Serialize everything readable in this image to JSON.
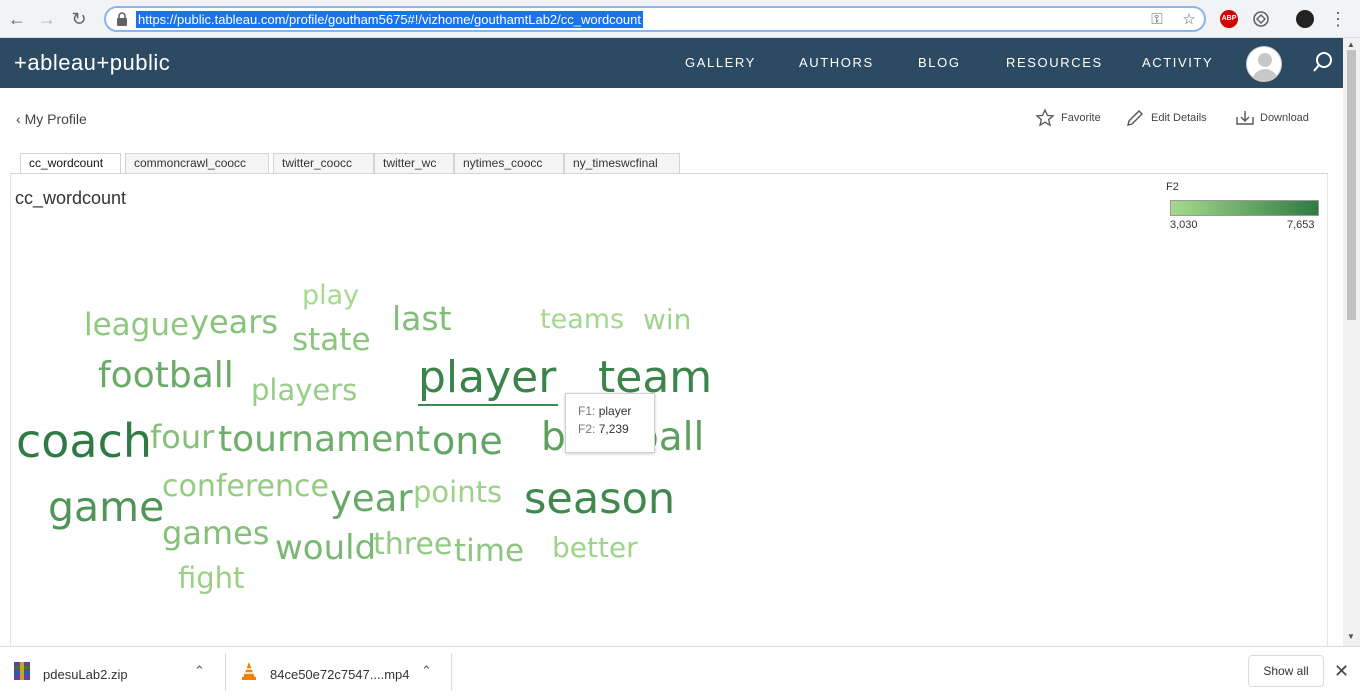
{
  "browser": {
    "url": "https://public.tableau.com/profile/goutham5675#!/vizhome/gouthamtLab2/cc_wordcount",
    "abp_label": "ABP"
  },
  "header": {
    "logo": "+ableau+public",
    "nav": [
      "GALLERY",
      "AUTHORS",
      "BLOG",
      "RESOURCES",
      "ACTIVITY"
    ]
  },
  "toolbar": {
    "back_label": "My Profile",
    "favorite": "Favorite",
    "edit": "Edit Details",
    "download": "Download"
  },
  "tabs": [
    "cc_wordcount",
    "commoncrawl_coocc",
    "twitter_coocc",
    "twitter_wc",
    "nytimes_coocc",
    "ny_timeswcfinal"
  ],
  "sheet_title": "cc_wordcount",
  "legend": {
    "title": "F2",
    "min": "3,030",
    "max": "7,653",
    "color_min": "#a5da8e",
    "color_max": "#2f7b43"
  },
  "tooltip": {
    "f1_key": "F1:",
    "f1_value": "player",
    "f2_key": "F2:",
    "f2_value": "7,239"
  },
  "downloads": {
    "items": [
      "pdesuLab2.zip",
      "84ce50e72c7547....mp4"
    ],
    "show_all": "Show all"
  },
  "chart_data": {
    "type": "wordcloud",
    "title": "cc_wordcount",
    "measure": "F2",
    "words": [
      {
        "text": "play",
        "weight": 3030
      },
      {
        "text": "league",
        "weight": 3900
      },
      {
        "text": "years",
        "weight": 4200
      },
      {
        "text": "state",
        "weight": 4100
      },
      {
        "text": "last",
        "weight": 4400
      },
      {
        "text": "teams",
        "weight": 3100
      },
      {
        "text": "win",
        "weight": 3300
      },
      {
        "text": "football",
        "weight": 5300
      },
      {
        "text": "players",
        "weight": 3600
      },
      {
        "text": "player",
        "weight": 7239
      },
      {
        "text": "team",
        "weight": 7200
      },
      {
        "text": "coach",
        "weight": 7653
      },
      {
        "text": "four",
        "weight": 4300
      },
      {
        "text": "tournament",
        "weight": 5200
      },
      {
        "text": "one",
        "weight": 5600
      },
      {
        "text": "baseball",
        "weight": 5900
      },
      {
        "text": "game",
        "weight": 6400
      },
      {
        "text": "conference",
        "weight": 3700
      },
      {
        "text": "year",
        "weight": 5400
      },
      {
        "text": "points",
        "weight": 3400
      },
      {
        "text": "season",
        "weight": 7000
      },
      {
        "text": "games",
        "weight": 4300
      },
      {
        "text": "would",
        "weight": 4700
      },
      {
        "text": "three",
        "weight": 3800
      },
      {
        "text": "time",
        "weight": 4000
      },
      {
        "text": "better",
        "weight": 3300
      },
      {
        "text": "fight",
        "weight": 3500
      }
    ]
  }
}
